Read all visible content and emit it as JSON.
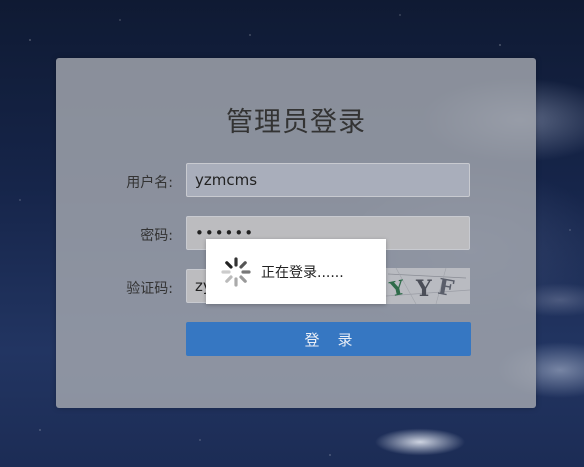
{
  "login": {
    "title": "管理员登录",
    "username_label": "用户名:",
    "username_value": "yzmcms",
    "password_label": "密码:",
    "password_value": "••••••",
    "captcha_label": "验证码:",
    "captcha_value": "zy",
    "captcha_image_text": "YYF",
    "submit_label": "登录"
  },
  "loading": {
    "icon": "spinner-icon",
    "text": "正在登录......"
  },
  "colors": {
    "button": "#3677c2",
    "panel": "#a5a8b0",
    "background": "#16254a"
  }
}
